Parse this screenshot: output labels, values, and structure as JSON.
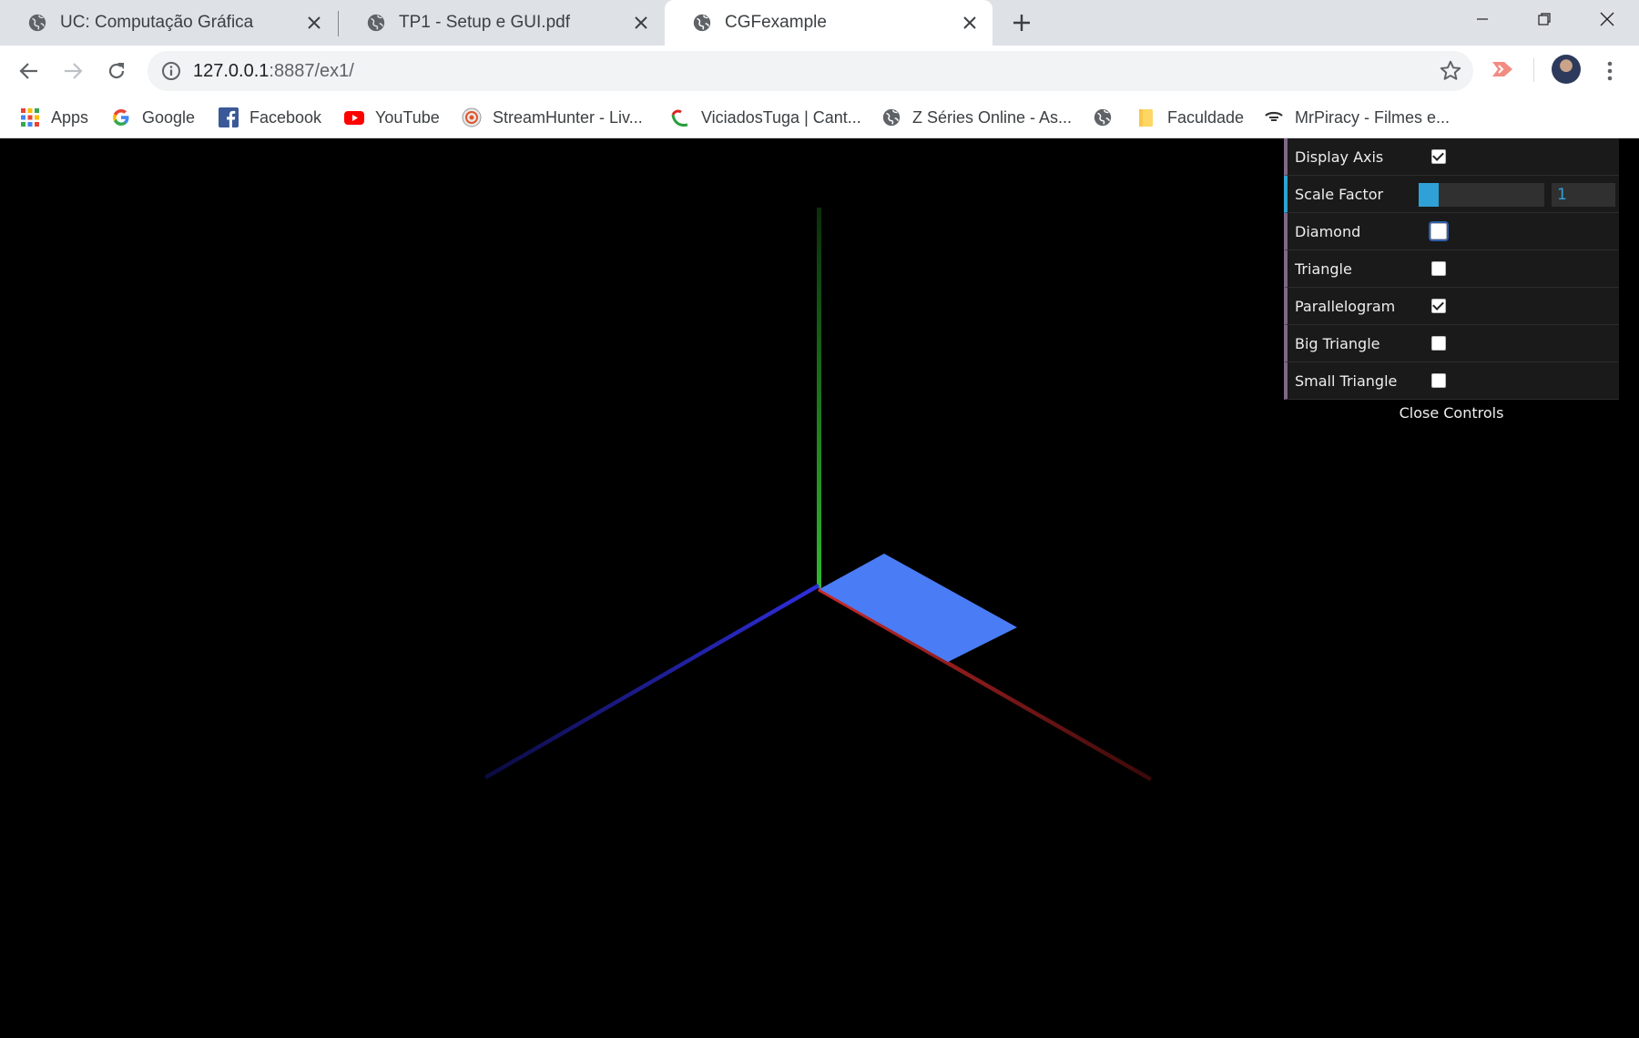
{
  "browser": {
    "tabs": [
      {
        "title": "UC: Computação Gráfica",
        "active": false
      },
      {
        "title": "TP1 - Setup e GUI.pdf",
        "active": false
      },
      {
        "title": "CGFexample",
        "active": true
      }
    ],
    "address": {
      "host": "127.0.0.1",
      "rest": ":8887/ex1/"
    },
    "bookmarks": [
      {
        "label": "Apps",
        "icon": "apps-grid-icon"
      },
      {
        "label": "Google",
        "icon": "google-icon"
      },
      {
        "label": "Facebook",
        "icon": "facebook-icon"
      },
      {
        "label": "YouTube",
        "icon": "youtube-icon"
      },
      {
        "label": "StreamHunter - Liv...",
        "icon": "streamhunter-icon"
      },
      {
        "label": "ViciadosTuga | Cant...",
        "icon": "viciadostuga-icon"
      },
      {
        "label": "Z Séries Online - As...",
        "icon": "globe-icon"
      },
      {
        "label": "",
        "icon": "globe-icon"
      },
      {
        "label": "Faculdade",
        "icon": "folder-icon"
      },
      {
        "label": "MrPiracy - Filmes e...",
        "icon": "mrpiracy-icon"
      }
    ]
  },
  "scene": {
    "background": "#000000",
    "axis_colors": {
      "x": "#cc2a2a",
      "y": "#2fb82f",
      "z": "#2f2fe0"
    },
    "parallelogram_color": "#4a7cf5"
  },
  "gui": {
    "controls": [
      {
        "label": "Display Axis",
        "type": "checkbox",
        "checked": true
      },
      {
        "label": "Scale Factor",
        "type": "number",
        "value": "1",
        "slider_fraction": 0.16
      },
      {
        "label": "Diamond",
        "type": "checkbox",
        "checked": false,
        "focused": true
      },
      {
        "label": "Triangle",
        "type": "checkbox",
        "checked": false
      },
      {
        "label": "Parallelogram",
        "type": "checkbox",
        "checked": true
      },
      {
        "label": "Big Triangle",
        "type": "checkbox",
        "checked": false
      },
      {
        "label": "Small Triangle",
        "type": "checkbox",
        "checked": false
      }
    ],
    "close_label": "Close Controls"
  }
}
